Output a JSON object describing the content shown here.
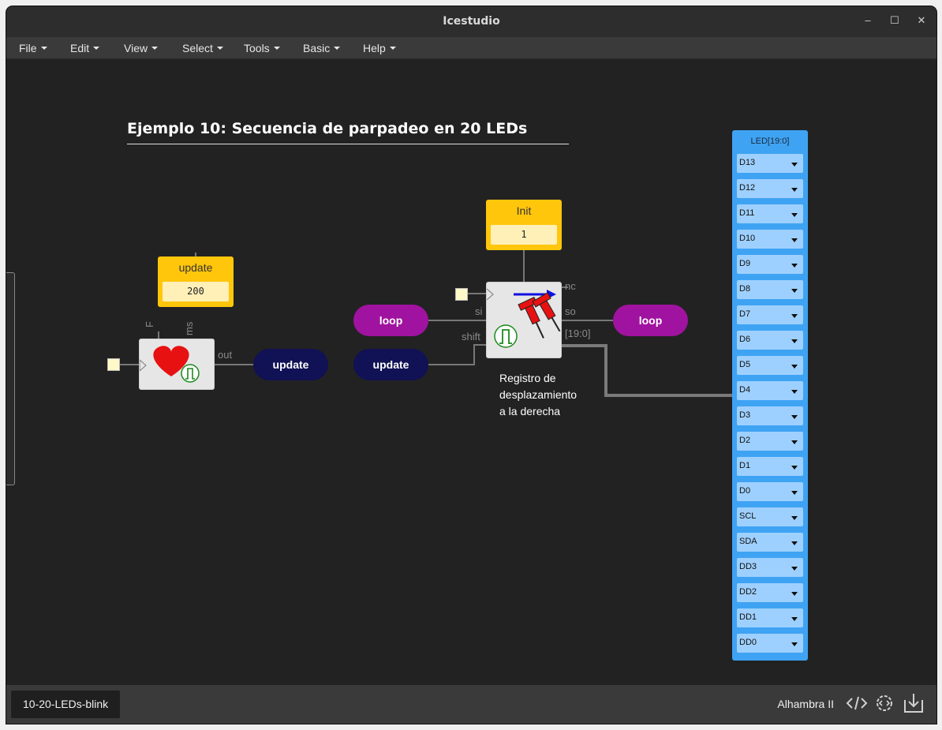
{
  "window": {
    "title": "Icestudio",
    "minimize": "–",
    "maximize": "☐",
    "close": "✕"
  },
  "menu": [
    {
      "label": "File"
    },
    {
      "label": "Edit"
    },
    {
      "label": "View"
    },
    {
      "label": "Select"
    },
    {
      "label": "Tools"
    },
    {
      "label": "Basic"
    },
    {
      "label": "Help"
    }
  ],
  "canvas": {
    "doc_title": "Ejemplo 10: Secuencia de parpadeo en 20 LEDs",
    "const_update": {
      "name": "update",
      "value": "200"
    },
    "const_init": {
      "name": "Init",
      "value": "1"
    },
    "heart_module": {
      "pin_f": "F",
      "pin_ms": "ms",
      "pin_out": "out",
      "icon": "heart-icon"
    },
    "shift_module": {
      "pin_nc": "nc",
      "pin_si": "si",
      "pin_so": "so",
      "pin_shift": "shift",
      "pin_bus": "[19:0]",
      "icon": "pushpin-icon"
    },
    "tags": {
      "update_out": "update",
      "loop_in": "loop",
      "update_in": "update",
      "loop_out": "loop"
    },
    "comment": [
      "Registro de",
      "desplazamiento",
      "a la derecha"
    ],
    "led_panel": {
      "title": "LED[19:0]",
      "pins": [
        "D13",
        "D12",
        "D11",
        "D10",
        "D9",
        "D8",
        "D7",
        "D6",
        "D5",
        "D4",
        "D3",
        "D2",
        "D1",
        "D0",
        "SCL",
        "SDA",
        "DD3",
        "DD2",
        "DD1",
        "DD0"
      ]
    }
  },
  "footer": {
    "project_tab": "10-20-LEDs-blink",
    "board": "Alhambra II"
  },
  "colors": {
    "accent_blue": "#3fa3f3",
    "const_yellow": "#ffc60b",
    "tag_purple": "#a013a0",
    "tag_navy": "#111155"
  }
}
